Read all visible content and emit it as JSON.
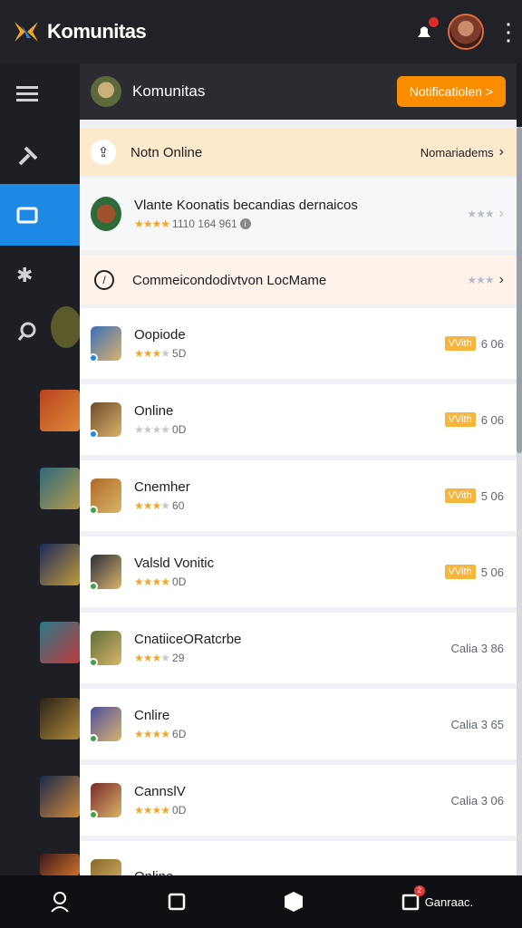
{
  "app": {
    "title": "Komunitas"
  },
  "panel": {
    "title": "Komunitas",
    "notification_button": "Notificatiolen >",
    "status_row": {
      "label": "Notn Online",
      "right": "Nomariadems"
    },
    "featured": {
      "title": "Vlante Koonatis becandias dernaicos",
      "meta": "1110 164 961",
      "rating": 4
    },
    "compose_row": {
      "label": "Commeicondodivtvon LocMame",
      "rating": 3
    },
    "items": [
      {
        "title": "Oopiode",
        "count": "5D",
        "rating": 3,
        "tag": "VVith",
        "value": "6 06",
        "thumb": "#3b6fb8",
        "dot": "#1e88e5"
      },
      {
        "title": "Online",
        "count": "0D",
        "rating": 0,
        "tag": "VVith",
        "value": "6 06",
        "thumb": "#6e4a2c",
        "dot": "#1e88e5"
      },
      {
        "title": "Cnemher",
        "count": "60",
        "rating": 3,
        "tag": "VVith",
        "value": "5 06",
        "thumb": "#b06a2a",
        "dot": "#43a047"
      },
      {
        "title": "Valsld Vonitic",
        "count": "0D",
        "rating": 4,
        "tag": "VVith",
        "value": "5 06",
        "thumb": "#2b2f3a",
        "dot": "#43a047"
      },
      {
        "title": "CnatiiceORatcrbe",
        "count": "29",
        "rating": 3,
        "tag": "",
        "value": "Calia 3 86",
        "thumb": "#5c6f3a",
        "dot": "#43a047"
      },
      {
        "title": "Cnlire",
        "count": "6D",
        "rating": 4,
        "tag": "",
        "value": "Calia 3 65",
        "thumb": "#4a4fa0",
        "dot": "#43a047"
      },
      {
        "title": "CannslV",
        "count": "0D",
        "rating": 4,
        "tag": "",
        "value": "Calia 3 06",
        "thumb": "#7a2a2a",
        "dot": "#43a047"
      },
      {
        "title": "Online",
        "count": "",
        "rating": 0,
        "tag": "",
        "value": "",
        "thumb": "#8a6a2a",
        "dot": "#43a047"
      }
    ]
  },
  "bottom_nav": {
    "last_label": "Ganraac.",
    "badge": "2"
  },
  "colors": {
    "accent": "#fb8c00",
    "rail_active": "#1e88e5"
  }
}
